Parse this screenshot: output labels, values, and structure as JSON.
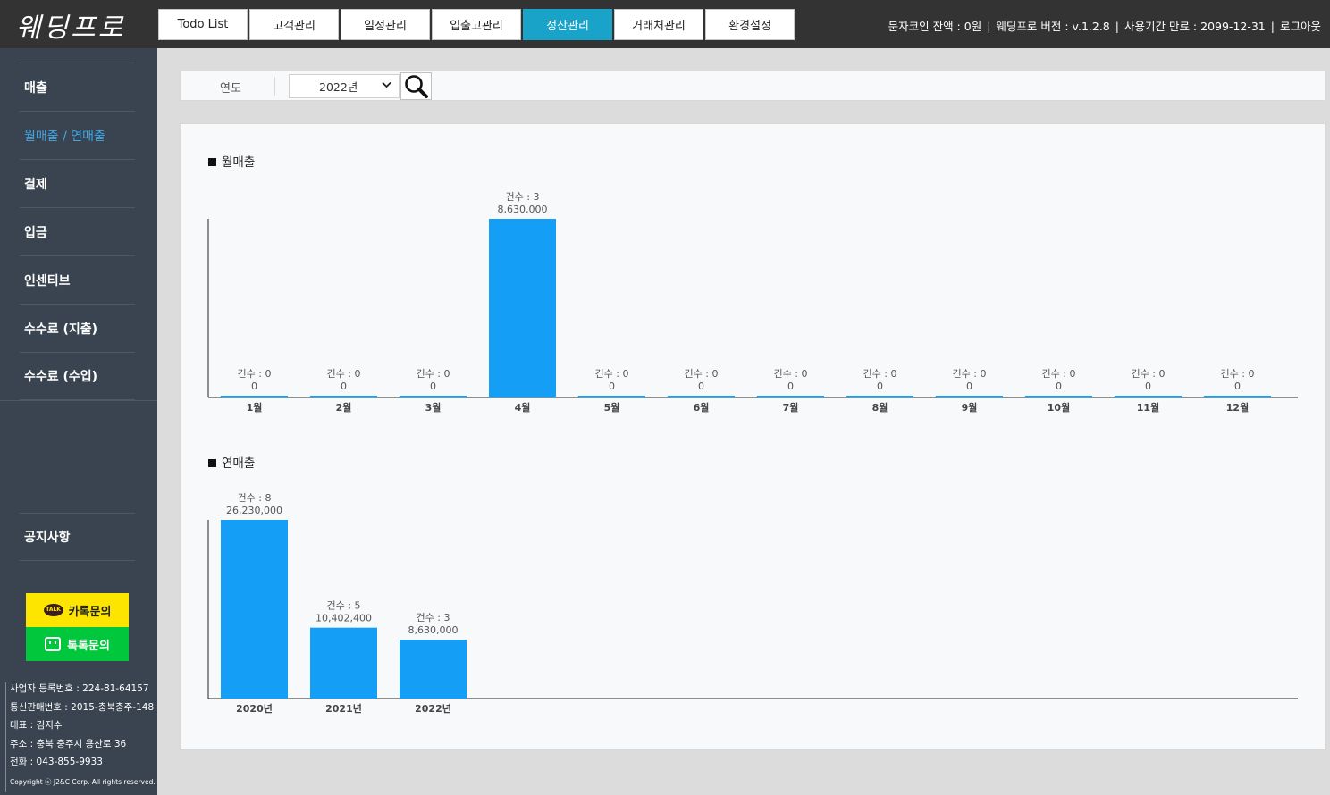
{
  "app": {
    "logo_text": "웨딩프로"
  },
  "nav": {
    "tabs": [
      {
        "label": "Todo List",
        "active": false
      },
      {
        "label": "고객관리",
        "active": false
      },
      {
        "label": "일정관리",
        "active": false
      },
      {
        "label": "입출고관리",
        "active": false
      },
      {
        "label": "정산관리",
        "active": true
      },
      {
        "label": "거래처관리",
        "active": false
      },
      {
        "label": "환경설정",
        "active": false
      }
    ]
  },
  "header_info": {
    "sms_balance": "문자코인 잔액 : 0원",
    "version": "웨딩프로 버전 : v.1.2.8",
    "expiry": "사용기간 만료 : 2099-12-31",
    "separator": "|",
    "logout_label": "로그아웃"
  },
  "sidebar": {
    "items": [
      {
        "label": "매출",
        "active": false
      },
      {
        "label": "월매출 / 연매출",
        "active": true
      },
      {
        "label": "결제",
        "active": false
      },
      {
        "label": "입금",
        "active": false
      },
      {
        "label": "인센티브",
        "active": false
      },
      {
        "label": "수수료 (지출)",
        "active": false
      },
      {
        "label": "수수료 (수입)",
        "active": false
      }
    ],
    "notice_label": "공지사항",
    "kakao_label": "카톡문의",
    "kakao_badge": "TALK",
    "talktalk_label": "톡톡문의",
    "company_info": [
      "사업자 등록번호 : 224-81-64157",
      "통신판매번호 : 2015-충북충주-148",
      "대표 : 김지수",
      "주소 : 충북 충주시 용산로 36",
      "전화 : 043-855-9933"
    ],
    "copyright": "Copyright ⓒ J2&C Corp. All rights reserved."
  },
  "filter": {
    "year_label": "연도",
    "year_value": "2022년"
  },
  "colors": {
    "bar": "#149ef5",
    "active_tab": "#19a3c9",
    "sidebar_bg": "#394450",
    "topbar_bg": "#333333"
  },
  "chart_data": [
    {
      "type": "bar",
      "title": "월매출",
      "categories": [
        "1월",
        "2월",
        "3월",
        "4월",
        "5월",
        "6월",
        "7월",
        "8월",
        "9월",
        "10월",
        "11월",
        "12월"
      ],
      "values": [
        0,
        0,
        0,
        8630000,
        0,
        0,
        0,
        0,
        0,
        0,
        0,
        0
      ],
      "counts": [
        0,
        0,
        0,
        3,
        0,
        0,
        0,
        0,
        0,
        0,
        0,
        0
      ],
      "value_labels": [
        "0",
        "0",
        "0",
        "8,630,000",
        "0",
        "0",
        "0",
        "0",
        "0",
        "0",
        "0",
        "0"
      ],
      "count_prefix": "건수 : ",
      "ylim": [
        0,
        8630000
      ],
      "grid": false
    },
    {
      "type": "bar",
      "title": "연매출",
      "categories": [
        "2020년",
        "2021년",
        "2022년"
      ],
      "values": [
        26230000,
        10402400,
        8630000
      ],
      "counts": [
        8,
        5,
        3
      ],
      "value_labels": [
        "26,230,000",
        "10,402,400",
        "8,630,000"
      ],
      "count_prefix": "건수 : ",
      "ylim": [
        0,
        26230000
      ],
      "grid": false
    }
  ]
}
